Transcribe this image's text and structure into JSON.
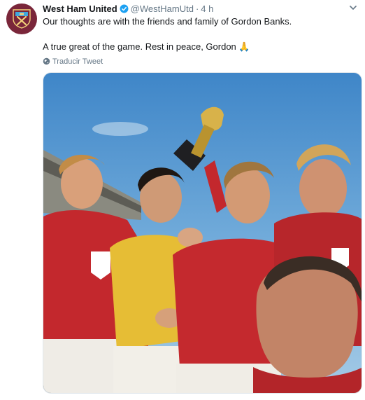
{
  "tweet": {
    "author_name": "West Ham United",
    "handle": "@WestHamUtd",
    "separator": "·",
    "time": "4 h",
    "verified": true,
    "text_line1": "Our thoughts are with the friends and family of Gordon Banks.",
    "text_line2": "A true great of the game. Rest in peace, Gordon",
    "emoji": "🙏",
    "translate_label": "Traducir Tweet"
  },
  "icons": {
    "avatar": "west-ham-crest-icon",
    "verified": "verified-badge-icon",
    "menu": "chevron-down-icon",
    "translate": "globe-icon"
  },
  "colors": {
    "brand_claret": "#7a263a",
    "verified_blue": "#1da1f2",
    "muted_text": "#657786"
  }
}
